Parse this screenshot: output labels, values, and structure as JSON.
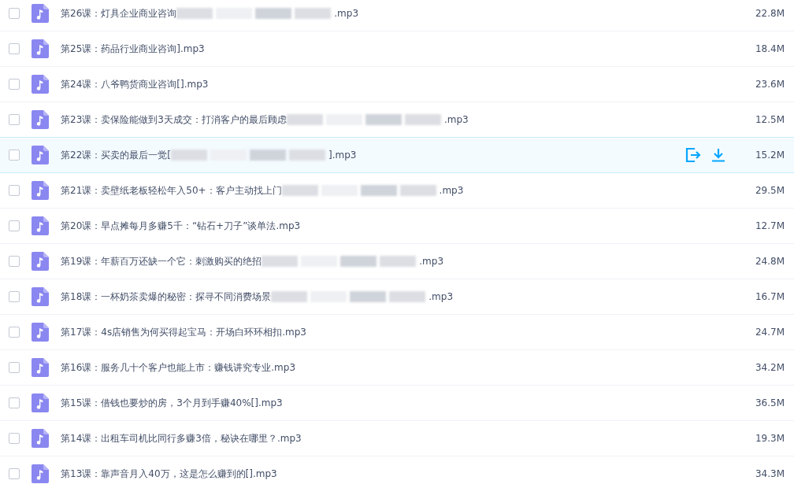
{
  "files": [
    {
      "name": "第26课：灯具企业商业咨询",
      "blurred": true,
      "name_end": ".mp3",
      "size": "22.8M",
      "checked": false,
      "hovered": false
    },
    {
      "name": "第25课：药品行业商业咨询].mp3",
      "blurred": false,
      "size": "18.4M",
      "checked": false,
      "hovered": false
    },
    {
      "name": "第24课：八爷鸭货商业咨询[].mp3",
      "blurred": false,
      "size": "23.6M",
      "checked": false,
      "hovered": false
    },
    {
      "name": "第23课：卖保险能做到3天成交：打消客户的最后顾虑",
      "blurred": true,
      "name_end": ".mp3",
      "size": "12.5M",
      "checked": false,
      "hovered": false
    },
    {
      "name": "第22课：买卖的最后一觉[",
      "blurred": true,
      "name_end": "].mp3",
      "size": "15.2M",
      "checked": false,
      "hovered": true
    },
    {
      "name": "第21课：卖壁纸老板轻松年入50+：客户主动找上门",
      "blurred": true,
      "name_end": ".mp3",
      "size": "29.5M",
      "checked": false,
      "hovered": false
    },
    {
      "name": "第20课：早点摊每月多赚5千：“钻石+刀子”谈单法.mp3",
      "blurred": false,
      "size": "12.7M",
      "checked": false,
      "hovered": false
    },
    {
      "name": "第19课：年薪百万还缺一个它：刺激购买的绝招",
      "blurred": true,
      "name_end": ".mp3",
      "size": "24.8M",
      "checked": false,
      "hovered": false
    },
    {
      "name": "第18课：一杯奶茶卖爆的秘密：探寻不同消费场景",
      "blurred": true,
      "name_end": ".mp3",
      "size": "16.7M",
      "checked": false,
      "hovered": false
    },
    {
      "name": "第17课：4s店销售为何买得起宝马：开场白环环相扣.mp3",
      "blurred": false,
      "size": "24.7M",
      "checked": false,
      "hovered": false
    },
    {
      "name": "第16课：服务几十个客户也能上市：赚钱讲究专业.mp3",
      "blurred": false,
      "size": "34.2M",
      "checked": false,
      "hovered": false
    },
    {
      "name": "第15课：借钱也要炒的房，3个月到手赚40%[].mp3",
      "blurred": false,
      "size": "36.5M",
      "checked": false,
      "hovered": false
    },
    {
      "name": "第14课：出租车司机比同行多赚3倍，秘诀在哪里？.mp3",
      "blurred": false,
      "size": "19.3M",
      "checked": false,
      "hovered": false
    },
    {
      "name": "第13课：靠声音月入40万，这是怎么赚到的[].mp3",
      "blurred": false,
      "size": "34.3M",
      "checked": false,
      "hovered": false
    }
  ]
}
